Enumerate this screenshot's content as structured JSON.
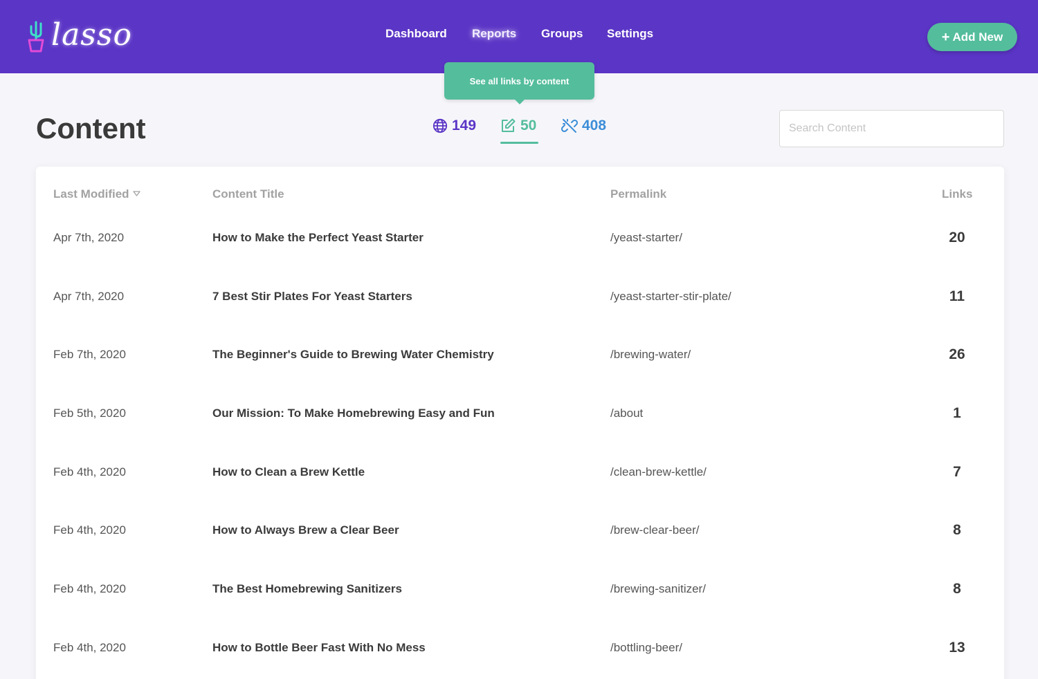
{
  "brand": {
    "name": "lasso"
  },
  "nav": {
    "items": [
      {
        "label": "Dashboard"
      },
      {
        "label": "Reports"
      },
      {
        "label": "Groups"
      },
      {
        "label": "Settings"
      }
    ],
    "active": "Reports"
  },
  "add_button": {
    "icon": "+",
    "label": "Add New"
  },
  "tooltip": {
    "text": "See all links by content"
  },
  "page": {
    "title": "Content"
  },
  "stats": {
    "sites": {
      "icon": "globe-icon",
      "value": "149"
    },
    "content": {
      "icon": "edit-icon",
      "value": "50",
      "active": true
    },
    "links": {
      "icon": "broken-link-icon",
      "value": "408"
    }
  },
  "search": {
    "placeholder": "Search Content",
    "value": ""
  },
  "table": {
    "columns": [
      "Last Modified",
      "Content Title",
      "Permalink",
      "Links"
    ],
    "sort": {
      "column": "Last Modified",
      "direction": "desc"
    },
    "rows": [
      {
        "date": "Apr 7th, 2020",
        "title": "How to Make the Perfect Yeast Starter",
        "permalink": "/yeast-starter/",
        "links": "20"
      },
      {
        "date": "Apr 7th, 2020",
        "title": "7 Best Stir Plates For Yeast Starters",
        "permalink": "/yeast-starter-stir-plate/",
        "links": "11"
      },
      {
        "date": "Feb 7th, 2020",
        "title": "The Beginner's Guide to Brewing Water Chemistry",
        "permalink": "/brewing-water/",
        "links": "26"
      },
      {
        "date": "Feb 5th, 2020",
        "title": "Our Mission: To Make Homebrewing Easy and Fun",
        "permalink": "/about",
        "links": "1"
      },
      {
        "date": "Feb 4th, 2020",
        "title": "How to Clean a Brew Kettle",
        "permalink": "/clean-brew-kettle/",
        "links": "7"
      },
      {
        "date": "Feb 4th, 2020",
        "title": "How to Always Brew a Clear Beer",
        "permalink": "/brew-clear-beer/",
        "links": "8"
      },
      {
        "date": "Feb 4th, 2020",
        "title": "The Best Homebrewing Sanitizers",
        "permalink": "/brewing-sanitizer/",
        "links": "8"
      },
      {
        "date": "Feb 4th, 2020",
        "title": "How to Bottle Beer Fast With No Mess",
        "permalink": "/bottling-beer/",
        "links": "13"
      }
    ]
  },
  "colors": {
    "header_bg": "#5b35c6",
    "accent_green": "#54bd9c",
    "sites_purple": "#5b35c6",
    "links_blue": "#3d8ed8",
    "page_bg": "#f6f6fa"
  }
}
